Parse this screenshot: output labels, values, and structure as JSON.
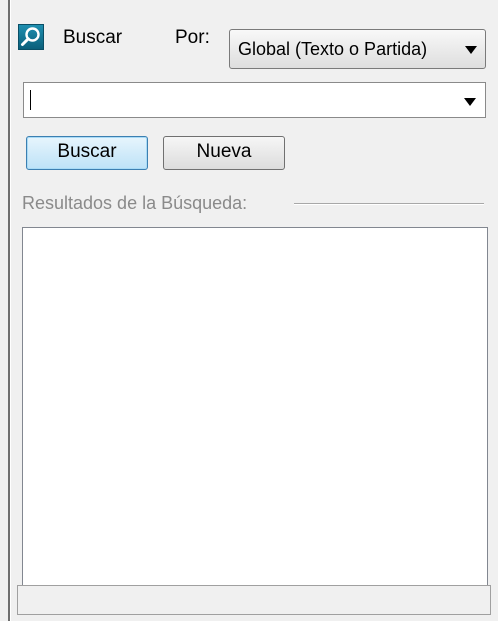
{
  "header": {
    "icon": "search-icon",
    "title": "Buscar",
    "scope_label": "Por:",
    "scope_value": "Global (Texto o Partida)"
  },
  "search": {
    "value": ""
  },
  "buttons": {
    "search_label": "Buscar",
    "new_label": "Nueva"
  },
  "results": {
    "group_label": "Resultados de la Búsqueda:",
    "items": []
  },
  "status": {
    "text": ""
  }
}
